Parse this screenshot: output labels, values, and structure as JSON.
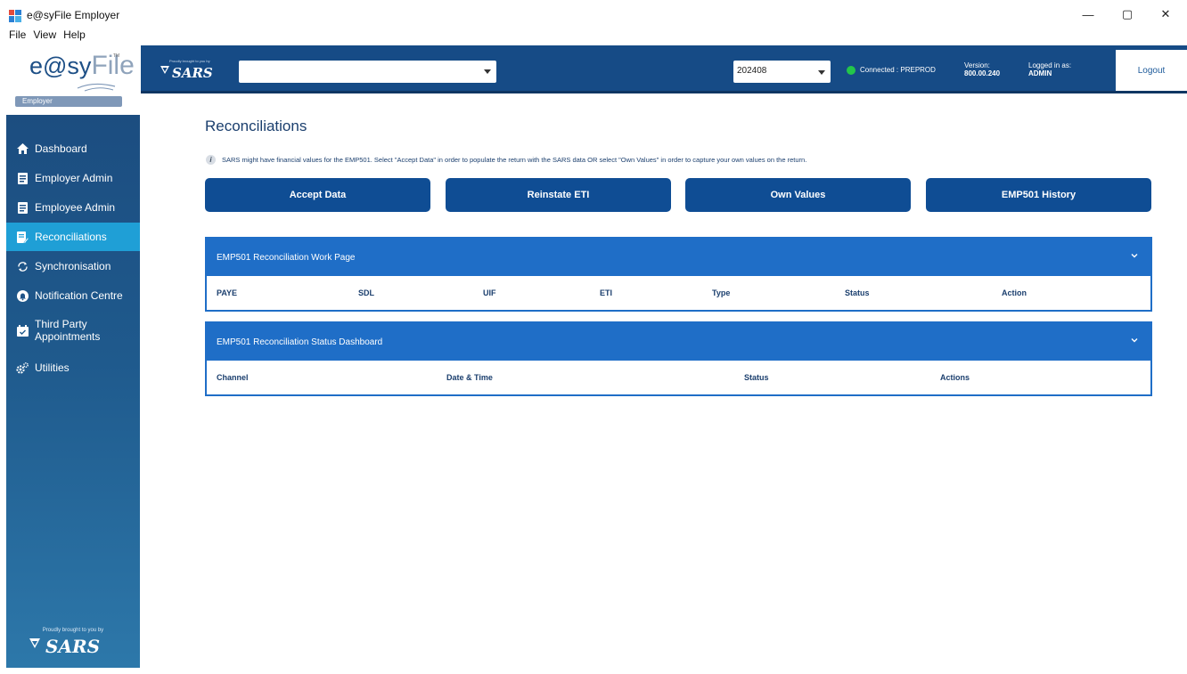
{
  "window": {
    "title": "e@syFile Employer",
    "minimize_glyph": "—",
    "maximize_glyph": "▢",
    "close_glyph": "✕"
  },
  "menu": [
    "File",
    "View",
    "Help"
  ],
  "logo": {
    "brand_prefix": "e@sy",
    "brand_suffix": "File",
    "tm": "TM",
    "badge": "Employer"
  },
  "sidebar": {
    "items": [
      {
        "label": "Dashboard",
        "icon": "home-icon"
      },
      {
        "label": "Employer Admin",
        "icon": "id-card-icon"
      },
      {
        "label": "Employee Admin",
        "icon": "id-card-icon"
      },
      {
        "label": "Reconciliations",
        "icon": "document-edit-icon",
        "active": true
      },
      {
        "label": "Synchronisation",
        "icon": "sync-icon"
      },
      {
        "label": "Notification Centre",
        "icon": "bell-icon"
      },
      {
        "label_line1": "Third Party",
        "label_line2": "Appointments",
        "icon": "calendar-check-icon"
      },
      {
        "label": "Utilities",
        "icon": "gears-icon"
      }
    ],
    "footer_text": "Proudly brought to you by",
    "footer_logo": "SARS"
  },
  "header": {
    "proud_text": "Proudly brought to you by",
    "logo": "SARS",
    "employer_select_value": "",
    "period_value": "202408",
    "connection_status": "Connected : PREPROD",
    "version_label": "Version:",
    "version_value": "800.00.240",
    "logged_in_label": "Logged in as:",
    "logged_in_user": "ADMIN",
    "logout_label": "Logout"
  },
  "main": {
    "title": "Reconciliations",
    "info_text": "SARS might have financial values for the EMP501. Select \"Accept Data\" in order to populate the return with the SARS data OR select \"Own Values\" in order to capture your own values on the return.",
    "buttons": [
      "Accept Data",
      "Reinstate ETI",
      "Own Values",
      "EMP501 History"
    ],
    "work_page": {
      "title": "EMP501 Reconciliation Work Page",
      "columns": [
        "PAYE",
        "SDL",
        "UIF",
        "ETI",
        "Type",
        "Status",
        "Action"
      ]
    },
    "status_dashboard": {
      "title": "EMP501 Reconciliation Status Dashboard",
      "columns": [
        "Channel",
        "Date & Time",
        "Status",
        "Actions"
      ]
    }
  },
  "colors": {
    "header_bg": "#164b86",
    "sidebar_active": "#1f9fd6",
    "button_bg": "#0f4d94",
    "panel_bg": "#1f6ec7",
    "connected_dot": "#23c64a"
  }
}
